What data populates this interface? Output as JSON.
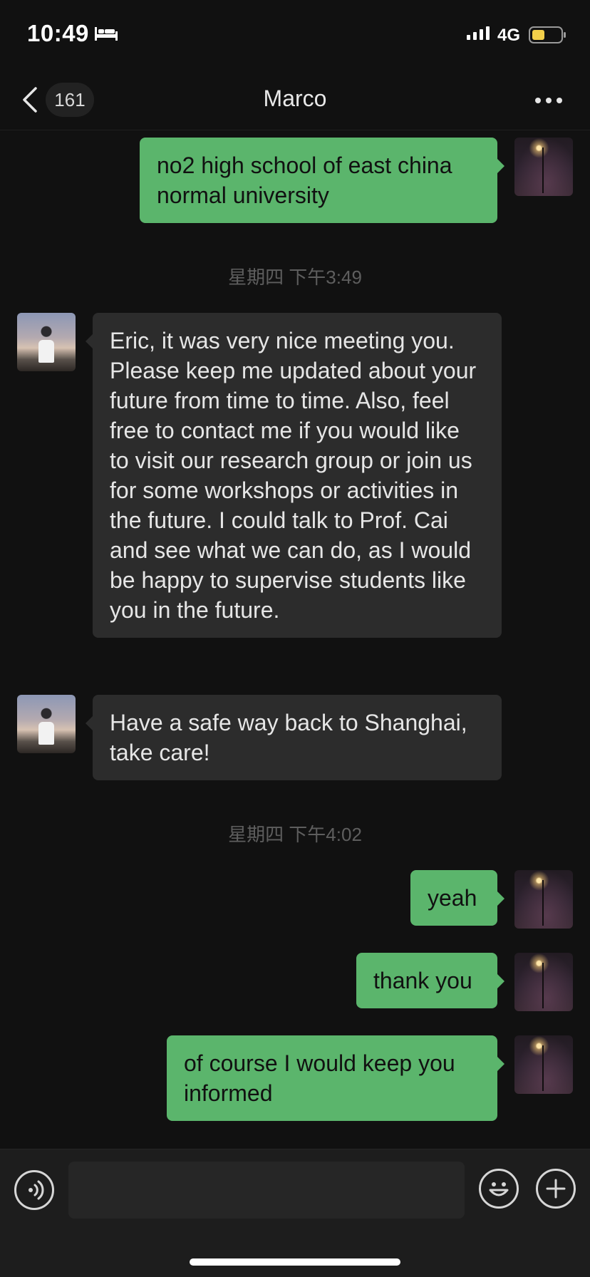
{
  "status_bar": {
    "time": "10:49",
    "network": "4G",
    "icons": [
      "bed-icon",
      "signal-icon",
      "battery-icon"
    ]
  },
  "nav": {
    "back_icon": "chevron-left-icon",
    "unread_count": "161",
    "title": "Marco",
    "more_icon": "more-dots-icon"
  },
  "messages": [
    {
      "from": "self",
      "text": "no2 high school of east china normal university"
    },
    {
      "type": "time",
      "text": "星期四 下午3:49"
    },
    {
      "from": "Marco",
      "text": "Eric, it was very nice meeting you. Please keep me updated about your future from time to time. Also, feel free to contact me if you  would like to visit our research group or join us for some workshops or activities in the future. I could talk to Prof. Cai and see what we can do, as I would be happy to supervise students like you in the future."
    },
    {
      "from": "Marco",
      "text": "Have a safe way back to Shanghai,  take care!"
    },
    {
      "type": "time",
      "text": "星期四 下午4:02"
    },
    {
      "from": "self",
      "text": "yeah"
    },
    {
      "from": "self",
      "text": "thank you"
    },
    {
      "from": "self",
      "text": "of course I would keep you informed"
    }
  ],
  "input_bar": {
    "voice_icon": "voice-icon",
    "text_value": "",
    "emoji_icon": "emoji-icon",
    "plus_icon": "plus-icon"
  },
  "colors": {
    "background": "#111111",
    "outgoing_bubble": "#5bb56c",
    "incoming_bubble": "#2c2c2c",
    "battery_level": "#f2cf4a"
  }
}
